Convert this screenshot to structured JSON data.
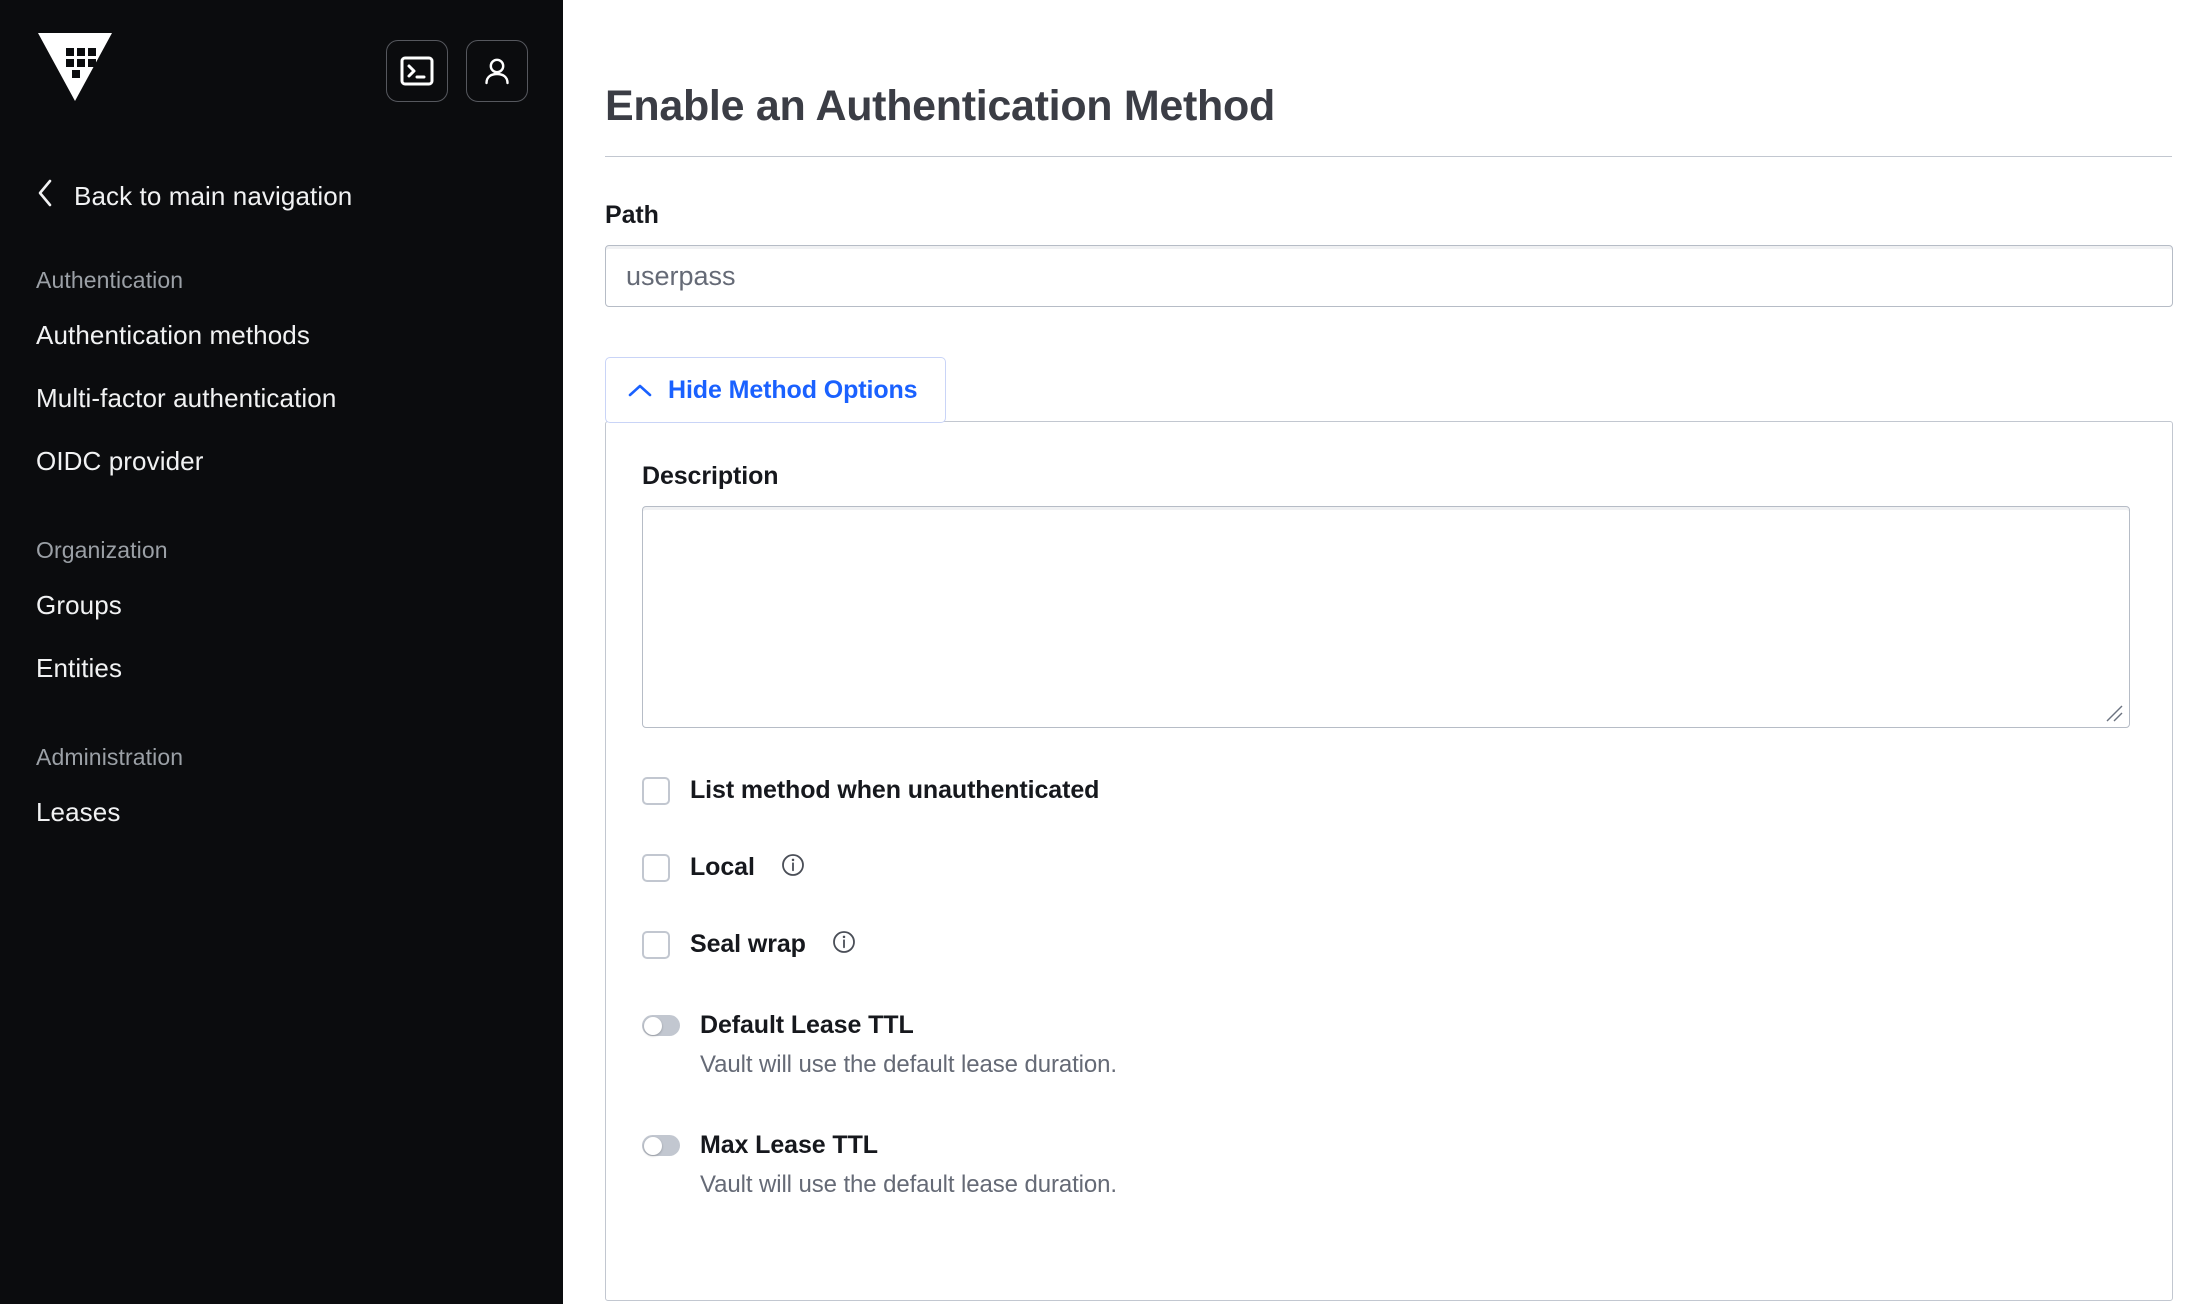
{
  "sidebar": {
    "logo_icon": "vault-logo-icon",
    "actions": [
      {
        "icon": "terminal-icon",
        "name": "console-toggle-button"
      },
      {
        "icon": "user-icon",
        "name": "user-menu-button"
      }
    ],
    "back_link": {
      "label": "Back to main navigation",
      "icon": "chevron-left-icon"
    },
    "groups": [
      {
        "title": "Authentication",
        "items": [
          {
            "label": "Authentication methods"
          },
          {
            "label": "Multi-factor authentication"
          },
          {
            "label": "OIDC provider"
          }
        ]
      },
      {
        "title": "Organization",
        "items": [
          {
            "label": "Groups"
          },
          {
            "label": "Entities"
          }
        ]
      },
      {
        "title": "Administration",
        "items": [
          {
            "label": "Leases"
          }
        ]
      }
    ]
  },
  "main": {
    "page_title": "Enable an Authentication Method",
    "path_field": {
      "label": "Path",
      "value": "userpass",
      "placeholder": "userpass"
    },
    "options_toggle": {
      "label": "Hide Method Options",
      "icon": "chevron-up-icon"
    },
    "description_field": {
      "label": "Description",
      "value": "",
      "placeholder": ""
    },
    "checkboxes": [
      {
        "label": "List method when unauthenticated",
        "checked": false,
        "has_info": false
      },
      {
        "label": "Local",
        "checked": false,
        "has_info": true
      },
      {
        "label": "Seal wrap",
        "checked": false,
        "has_info": true
      }
    ],
    "toggles": [
      {
        "label": "Default Lease TTL",
        "enabled": false,
        "help": "Vault will use the default lease duration."
      },
      {
        "label": "Max Lease TTL",
        "enabled": false,
        "help": "Vault will use the default lease duration."
      }
    ]
  },
  "colors": {
    "sidebar_bg": "#0b0c0e",
    "accent_blue": "#1a61ff",
    "border_gray": "#c2c7d0",
    "text_dark": "#16181d",
    "text_muted": "#656a76"
  }
}
